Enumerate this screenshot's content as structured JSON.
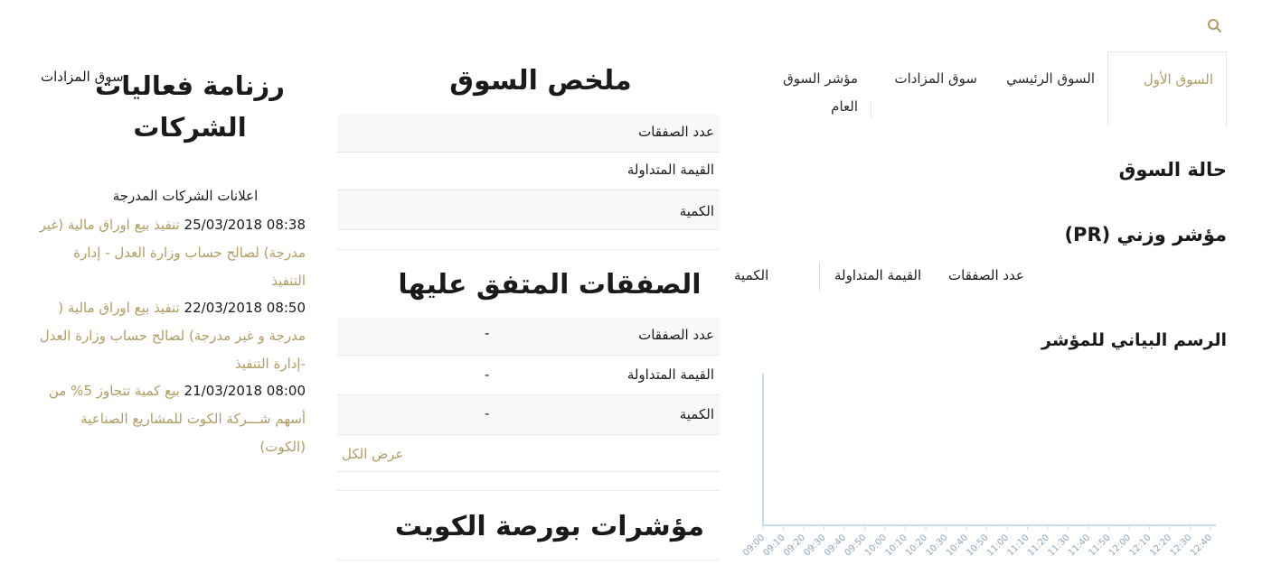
{
  "search": {
    "icon": "search-icon"
  },
  "tabs": [
    {
      "label": "السوق الأول",
      "active": true
    },
    {
      "label": "السوق الرئيسي",
      "active": false
    },
    {
      "label": "سوق المزادات",
      "active": false
    },
    {
      "label": "مؤشر السوق العام",
      "active": false
    }
  ],
  "market_status": {
    "title": "حالة السوق"
  },
  "index": {
    "title": "مؤشر وزني (PR)",
    "stats": {
      "deals": "عدد الصفقات",
      "value": "القيمة المتداولة",
      "quantity": "الكمية"
    }
  },
  "chart_section": {
    "title": "الرسم البياني للمؤشر"
  },
  "market_summary": {
    "title": "ملخص السوق",
    "rows": [
      {
        "label": "عدد الصفقات"
      },
      {
        "label": "القيمة المتداولة"
      },
      {
        "label": "الكمية"
      }
    ]
  },
  "agreed_deals": {
    "title": "الصفقات المتفق عليها",
    "rows": [
      {
        "label": "عدد الصفقات",
        "value": "-"
      },
      {
        "label": "القيمة المتداولة",
        "value": "-"
      },
      {
        "label": "الكمية",
        "value": "-"
      }
    ],
    "view_all": "عرض الكل"
  },
  "indices": {
    "title": "مؤشرات بورصة الكويت"
  },
  "calendar": {
    "title_line1": "رزنامة فعاليات",
    "title_line2": "الشركات",
    "overlay_link": "سوق المزادات",
    "announcements_title": "اعلانات الشركات المدرجة",
    "announcements": [
      {
        "timestamp": "25/03/2018 08:38",
        "text": "تنفيذ بيع اوراق مالية (غير مدرجة) لصالح حساب وزارة العدل - إدارة التنفيذ"
      },
      {
        "timestamp": "22/03/2018 08:50",
        "text": "تنفيذ بيع اوراق مالية ( مدرجة و غير مدرجة) لصالح حساب وزارة العدل -إدارة التنفيذ"
      },
      {
        "timestamp": "21/03/2018 08:00",
        "text": "بيع كمية تتجاوز 5% من أسهم شـــركة الكوت للمشاريع الصناعية (الكوت)"
      }
    ]
  },
  "chart_data": {
    "type": "line",
    "title": "",
    "xlabel": "",
    "ylabel": "",
    "x": [
      "09:00",
      "09:10",
      "09:20",
      "09:30",
      "09:40",
      "09:50",
      "10:00",
      "10:10",
      "10:20",
      "10:30",
      "10:40",
      "10:50",
      "11:00",
      "11:10",
      "11:20",
      "11:30",
      "11:40",
      "11:50",
      "12:00",
      "12:10",
      "12:20",
      "12:30",
      "12:40"
    ],
    "series": [],
    "grid": true,
    "axis_color": "#c9dcef",
    "tick_color": "#8fa7bd"
  },
  "colors": {
    "accent": "#b19d63",
    "text": "#1a1a1a",
    "row_shade": "#f8f8f8",
    "border": "#e8e8e8"
  }
}
